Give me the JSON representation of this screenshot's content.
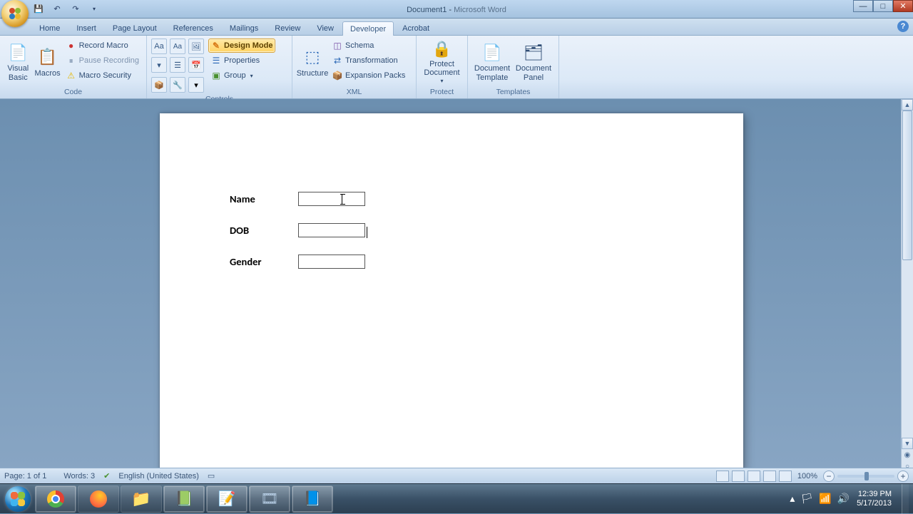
{
  "titlebar": {
    "document": "Document1",
    "sep": " - ",
    "app": "Microsoft Word"
  },
  "tabs": {
    "items": [
      "Home",
      "Insert",
      "Page Layout",
      "References",
      "Mailings",
      "Review",
      "View",
      "Developer",
      "Acrobat"
    ],
    "active": "Developer"
  },
  "ribbon": {
    "code": {
      "visual_basic": "Visual\nBasic",
      "macros": "Macros",
      "record_macro": "Record Macro",
      "pause_recording": "Pause Recording",
      "macro_security": "Macro Security",
      "label": "Code"
    },
    "controls": {
      "design_mode": "Design Mode",
      "properties": "Properties",
      "group": "Group",
      "label": "Controls"
    },
    "xml": {
      "structure": "Structure",
      "schema": "Schema",
      "transformation": "Transformation",
      "expansion_packs": "Expansion Packs",
      "label": "XML"
    },
    "protect": {
      "protect_document": "Protect\nDocument",
      "label": "Protect"
    },
    "templates": {
      "document_template": "Document\nTemplate",
      "document_panel": "Document\nPanel",
      "label": "Templates"
    }
  },
  "form": {
    "rows": [
      {
        "label": "Name"
      },
      {
        "label": "DOB"
      },
      {
        "label": "Gender"
      }
    ]
  },
  "status": {
    "page": "Page: 1 of 1",
    "words": "Words: 3",
    "language": "English (United States)",
    "zoom": "100%"
  },
  "tray": {
    "time": "12:39 PM",
    "date": "5/17/2013"
  }
}
